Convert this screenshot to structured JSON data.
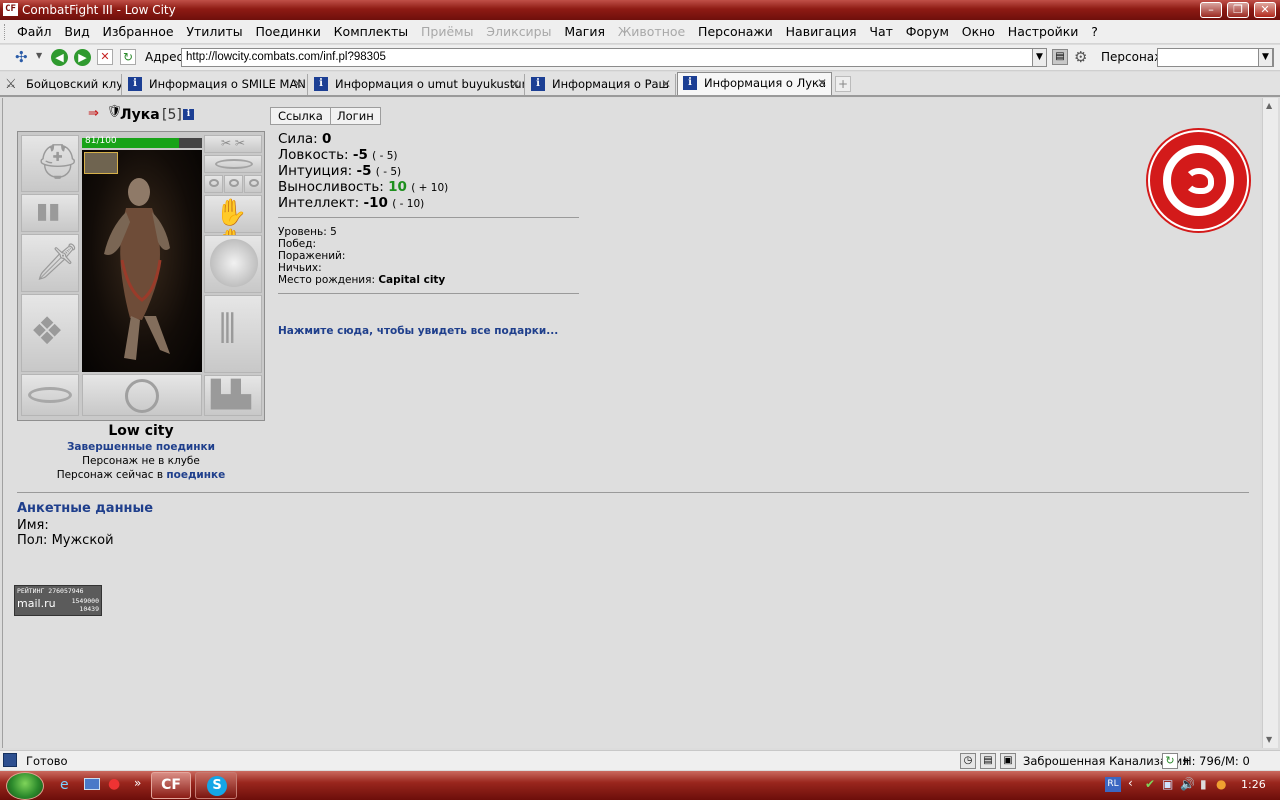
{
  "window": {
    "title": "CombatFight III - Low City",
    "app_icon": "CF"
  },
  "menu": [
    "Файл",
    "Вид",
    "Избранное",
    "Утилиты",
    "Поединки",
    "Комплекты",
    "Приёмы",
    "Эликсиры",
    "Магия",
    "Животное",
    "Персонажи",
    "Навигация",
    "Чат",
    "Форум",
    "Окно",
    "Настройки",
    "?"
  ],
  "menu_disabled": [
    "Приёмы",
    "Эликсиры",
    "Животное"
  ],
  "address": {
    "label": "Адрес:",
    "url": "http://lowcity.combats.com/inf.pl?98305"
  },
  "persona_label": "Персонаж:",
  "tabs": [
    {
      "label": "Бойцовский клуб",
      "icon": "crossed-swords-icon",
      "active": false
    },
    {
      "label": "Информация о SMILE MAN",
      "icon": "info-icon",
      "active": false
    },
    {
      "label": "Информация о umut buyukustun",
      "icon": "info-icon",
      "active": false
    },
    {
      "label": "Информация о Раш",
      "icon": "info-icon",
      "active": false
    },
    {
      "label": "Информация о Лука",
      "icon": "info-icon",
      "active": true
    }
  ],
  "character": {
    "name": "Лука",
    "level_badge": "[5]",
    "hp": "81/100",
    "hp_fraction": 0.81,
    "city": "Low city",
    "fights_link": "Завершенные поединки",
    "club_status": "Персонаж не в клубе",
    "now_prefix": "Персонаж сейчас в",
    "now_link": "поединке"
  },
  "buttons": {
    "link": "Ссылка",
    "login": "Логин"
  },
  "stats": [
    {
      "label": "Сила:",
      "value": "0",
      "mod": ""
    },
    {
      "label": "Ловкость:",
      "value": "-5",
      "mod": "( - 5)"
    },
    {
      "label": "Интуиция:",
      "value": "-5",
      "mod": "( - 5)"
    },
    {
      "label": "Выносливость:",
      "value": "10",
      "mod": "( + 10)"
    },
    {
      "label": "Интеллект:",
      "value": "-10",
      "mod": "( - 10)"
    }
  ],
  "info": {
    "level": "Уровень: 5",
    "wins": "Побед:",
    "losses": "Поражений:",
    "draws": "Ничьих:",
    "birthplace_label": "Место рождения:",
    "birthplace": "Capital city"
  },
  "gifts_link": "Нажмите сюда, чтобы увидеть все подарки...",
  "profile": {
    "title": "Анкетные данные",
    "name": "Имя:",
    "gender_label": "Пол:",
    "gender": "Мужской"
  },
  "counter": {
    "line1": "РЕЙТИНГ 276057946",
    "brand": "mail.ru",
    "n1": "1549000",
    "n2": "10439"
  },
  "status": {
    "text": "Готово",
    "location": "Заброшенная Канализация",
    "hp": "Н: 796/М: 0"
  },
  "taskbar": {
    "cf": "CF",
    "lang": "RL",
    "clock": "1:26"
  },
  "colors": {
    "accent": "#1f3f8c",
    "titlebar": "#8e1b14",
    "green": "#1e8f1e",
    "emblem": "#d31a1a"
  }
}
